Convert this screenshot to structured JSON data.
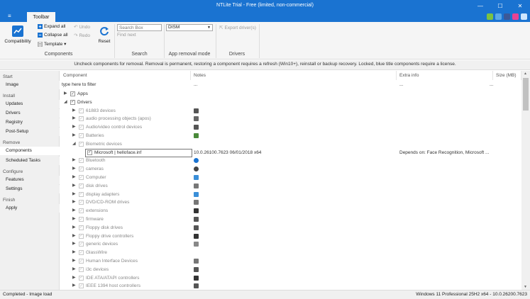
{
  "window": {
    "title": "NTLite Trial - Free (limited, non-commercial)",
    "min": "—",
    "max": "☐",
    "close": "✕"
  },
  "ribbon_tabs": {
    "menu": "≡",
    "toolbar": "Toolbar"
  },
  "ribbon": {
    "compatibility": "Compatibility",
    "expand_all": "Expand all",
    "collapse_all": "Collapse all",
    "template": "Template ▾",
    "undo": "Undo",
    "redo": "Redo",
    "reset": "Reset",
    "components_group": "Components",
    "search_placeholder": "Search Box",
    "find_next": "Find next",
    "search_group": "Search",
    "removal_mode_value": "DISM",
    "removal_mode_group": "App removal mode",
    "export_drivers": "Export driver(s)",
    "drivers_group": "Drivers"
  },
  "infobar": "Uncheck components for removal. Removal is permanent, restoring a component requires a refresh (Win10+), reinstall or backup recovery. Locked, blue title components require a license.",
  "sidebar": {
    "start": "Start",
    "image": "Image",
    "install": "Install",
    "updates": "Updates",
    "drivers": "Drivers",
    "registry": "Registry",
    "post_setup": "Post-Setup",
    "remove": "Remove",
    "components": "Components",
    "scheduled_tasks": "Scheduled Tasks",
    "configure": "Configure",
    "features": "Features",
    "settings": "Settings",
    "finish": "Finish",
    "apply": "Apply"
  },
  "grid": {
    "col_component": "Component",
    "col_notes": "Notes",
    "col_extra": "Extra info",
    "col_size": "Size (MB)",
    "filter_text": "type here to filter",
    "filter_notes": "...",
    "filter_extra": "...",
    "filter_size": "...",
    "rows": [
      {
        "label": "Apps",
        "arrow": "▶",
        "level": 0,
        "checked": true,
        "dim": false
      },
      {
        "label": "Drivers",
        "arrow": "◢",
        "level": 0,
        "checked": true,
        "dim": false
      },
      {
        "label": "61883 devices",
        "arrow": "▶",
        "level": 1,
        "checked": true,
        "dim": true,
        "icon": "plug"
      },
      {
        "label": "audio processing objects (apos)",
        "arrow": "▶",
        "level": 1,
        "checked": true,
        "dim": true,
        "icon": "speaker"
      },
      {
        "label": "Audio/video control devices",
        "arrow": "▶",
        "level": 1,
        "checked": true,
        "dim": true,
        "icon": "plug"
      },
      {
        "label": "Batteries",
        "arrow": "▶",
        "level": 1,
        "checked": true,
        "dim": true,
        "icon": "battery"
      },
      {
        "label": "Biometric devices",
        "arrow": "◢",
        "level": 1,
        "checked": true,
        "dim": true,
        "icon": "blank"
      },
      {
        "label": "Microsoft  |  helloface.inf",
        "arrow": "",
        "level": 2,
        "checked": true,
        "dim": false,
        "selected": true,
        "notes": "10.0.26100.7623  06/01/2018  x64",
        "extra": "Depends on: Face Recognition, Microsoft  ..."
      },
      {
        "label": "Bluetooth",
        "arrow": "▶",
        "level": 1,
        "checked": true,
        "dim": true,
        "icon": "bluetooth"
      },
      {
        "label": "cameras",
        "arrow": "▶",
        "level": 1,
        "checked": true,
        "dim": true,
        "icon": "camera"
      },
      {
        "label": "Computer",
        "arrow": "▶",
        "level": 1,
        "checked": true,
        "dim": true,
        "icon": "monitor"
      },
      {
        "label": "disk drives",
        "arrow": "▶",
        "level": 1,
        "checked": true,
        "dim": true,
        "icon": "disk"
      },
      {
        "label": "display adapters",
        "arrow": "▶",
        "level": 1,
        "checked": true,
        "dim": true,
        "icon": "monitor"
      },
      {
        "label": "DVD/CD-ROM drives",
        "arrow": "▶",
        "level": 1,
        "checked": true,
        "dim": true,
        "icon": "disk"
      },
      {
        "label": "extensions",
        "arrow": "▶",
        "level": 1,
        "checked": true,
        "dim": true,
        "icon": "ext"
      },
      {
        "label": "firmware",
        "arrow": "▶",
        "level": 1,
        "checked": true,
        "dim": true,
        "icon": "chip"
      },
      {
        "label": "Floppy disk drives",
        "arrow": "▶",
        "level": 1,
        "checked": true,
        "dim": true,
        "icon": "chip"
      },
      {
        "label": "Floppy drive controllers",
        "arrow": "▶",
        "level": 1,
        "checked": true,
        "dim": true,
        "icon": "ext"
      },
      {
        "label": "generic devices",
        "arrow": "▶",
        "level": 1,
        "checked": true,
        "dim": true,
        "icon": "box"
      },
      {
        "label": "GlassWire",
        "arrow": "▶",
        "level": 1,
        "checked": true,
        "dim": true,
        "icon": "blank"
      },
      {
        "label": "Human Interface Devices",
        "arrow": "▶",
        "level": 1,
        "checked": true,
        "dim": true,
        "icon": "keyboard"
      },
      {
        "label": "i3c devices",
        "arrow": "▶",
        "level": 1,
        "checked": true,
        "dim": true,
        "icon": "chip"
      },
      {
        "label": "IDE ATA/ATAPI controllers",
        "arrow": "▶",
        "level": 1,
        "checked": true,
        "dim": true,
        "icon": "ext"
      },
      {
        "label": "IEEE 1394 host controllers",
        "arrow": "▶",
        "level": 1,
        "checked": true,
        "dim": true,
        "icon": "plug"
      }
    ]
  },
  "status": {
    "left": "Completed - Image load",
    "right": "Windows 11 Professional 25H2 x64 - 10.0.26200.7623"
  },
  "colors": {
    "accent": "#1a73d1"
  }
}
